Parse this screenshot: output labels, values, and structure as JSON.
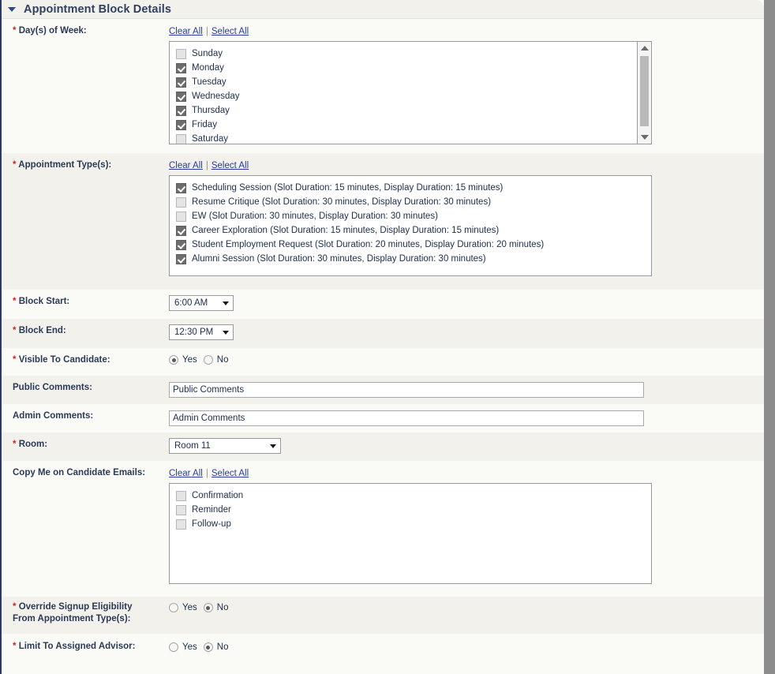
{
  "header": {
    "title": "Appointment Block Details",
    "collapse_icon": "triangle-down-icon"
  },
  "links": {
    "clear_all": "Clear All",
    "select_all": "Select All",
    "separator": "|"
  },
  "fields": {
    "days_of_week": {
      "label": "Day(s) of Week:",
      "required": true,
      "options": [
        {
          "label": "Sunday",
          "checked": false
        },
        {
          "label": "Monday",
          "checked": true
        },
        {
          "label": "Tuesday",
          "checked": true
        },
        {
          "label": "Wednesday",
          "checked": true
        },
        {
          "label": "Thursday",
          "checked": true
        },
        {
          "label": "Friday",
          "checked": true
        },
        {
          "label": "Saturday",
          "checked": false
        }
      ]
    },
    "appointment_types": {
      "label": "Appointment Type(s):",
      "required": true,
      "options": [
        {
          "label": "Scheduling Session (Slot Duration: 15 minutes, Display Duration: 15 minutes)",
          "checked": true
        },
        {
          "label": "Resume Critique (Slot Duration: 30 minutes, Display Duration: 30 minutes)",
          "checked": false
        },
        {
          "label": "EW (Slot Duration: 30 minutes, Display Duration: 30 minutes)",
          "checked": false
        },
        {
          "label": "Career Exploration (Slot Duration: 15 minutes, Display Duration: 15 minutes)",
          "checked": true
        },
        {
          "label": "Student Employment Request (Slot Duration: 20 minutes, Display Duration: 20 minutes)",
          "checked": true
        },
        {
          "label": "Alumni Session (Slot Duration: 30 minutes, Display Duration: 30 minutes)",
          "checked": true
        }
      ]
    },
    "block_start": {
      "label": "Block Start:",
      "required": true,
      "value": "6:00 AM"
    },
    "block_end": {
      "label": "Block End:",
      "required": true,
      "value": "12:30 PM"
    },
    "visible_to_candidate": {
      "label": "Visible To Candidate:",
      "required": true,
      "yes": "Yes",
      "no": "No",
      "selected": "Yes"
    },
    "public_comments": {
      "label": "Public Comments:",
      "required": false,
      "value": "Public Comments"
    },
    "admin_comments": {
      "label": "Admin Comments:",
      "required": false,
      "value": "Admin Comments"
    },
    "room": {
      "label": "Room:",
      "required": true,
      "value": "Room 11"
    },
    "copy_me_emails": {
      "label": "Copy Me on Candidate Emails:",
      "required": false,
      "options": [
        {
          "label": "Confirmation",
          "checked": false
        },
        {
          "label": "Reminder",
          "checked": false
        },
        {
          "label": "Follow-up",
          "checked": false
        }
      ]
    },
    "override_signup_eligibility": {
      "label_line1": "Override Signup Eligibility",
      "label_line2": "From Appointment Type(s):",
      "required": true,
      "yes": "Yes",
      "no": "No",
      "selected": "No"
    },
    "limit_to_assigned_advisor": {
      "label": "Limit To Assigned Advisor:",
      "required": true,
      "yes": "Yes",
      "no": "No",
      "selected": "No"
    }
  },
  "colors": {
    "required_marker": "#cc2222",
    "link": "#2b3a9c",
    "title": "#31415f",
    "checkbox_checked": "#6d6d6d"
  }
}
